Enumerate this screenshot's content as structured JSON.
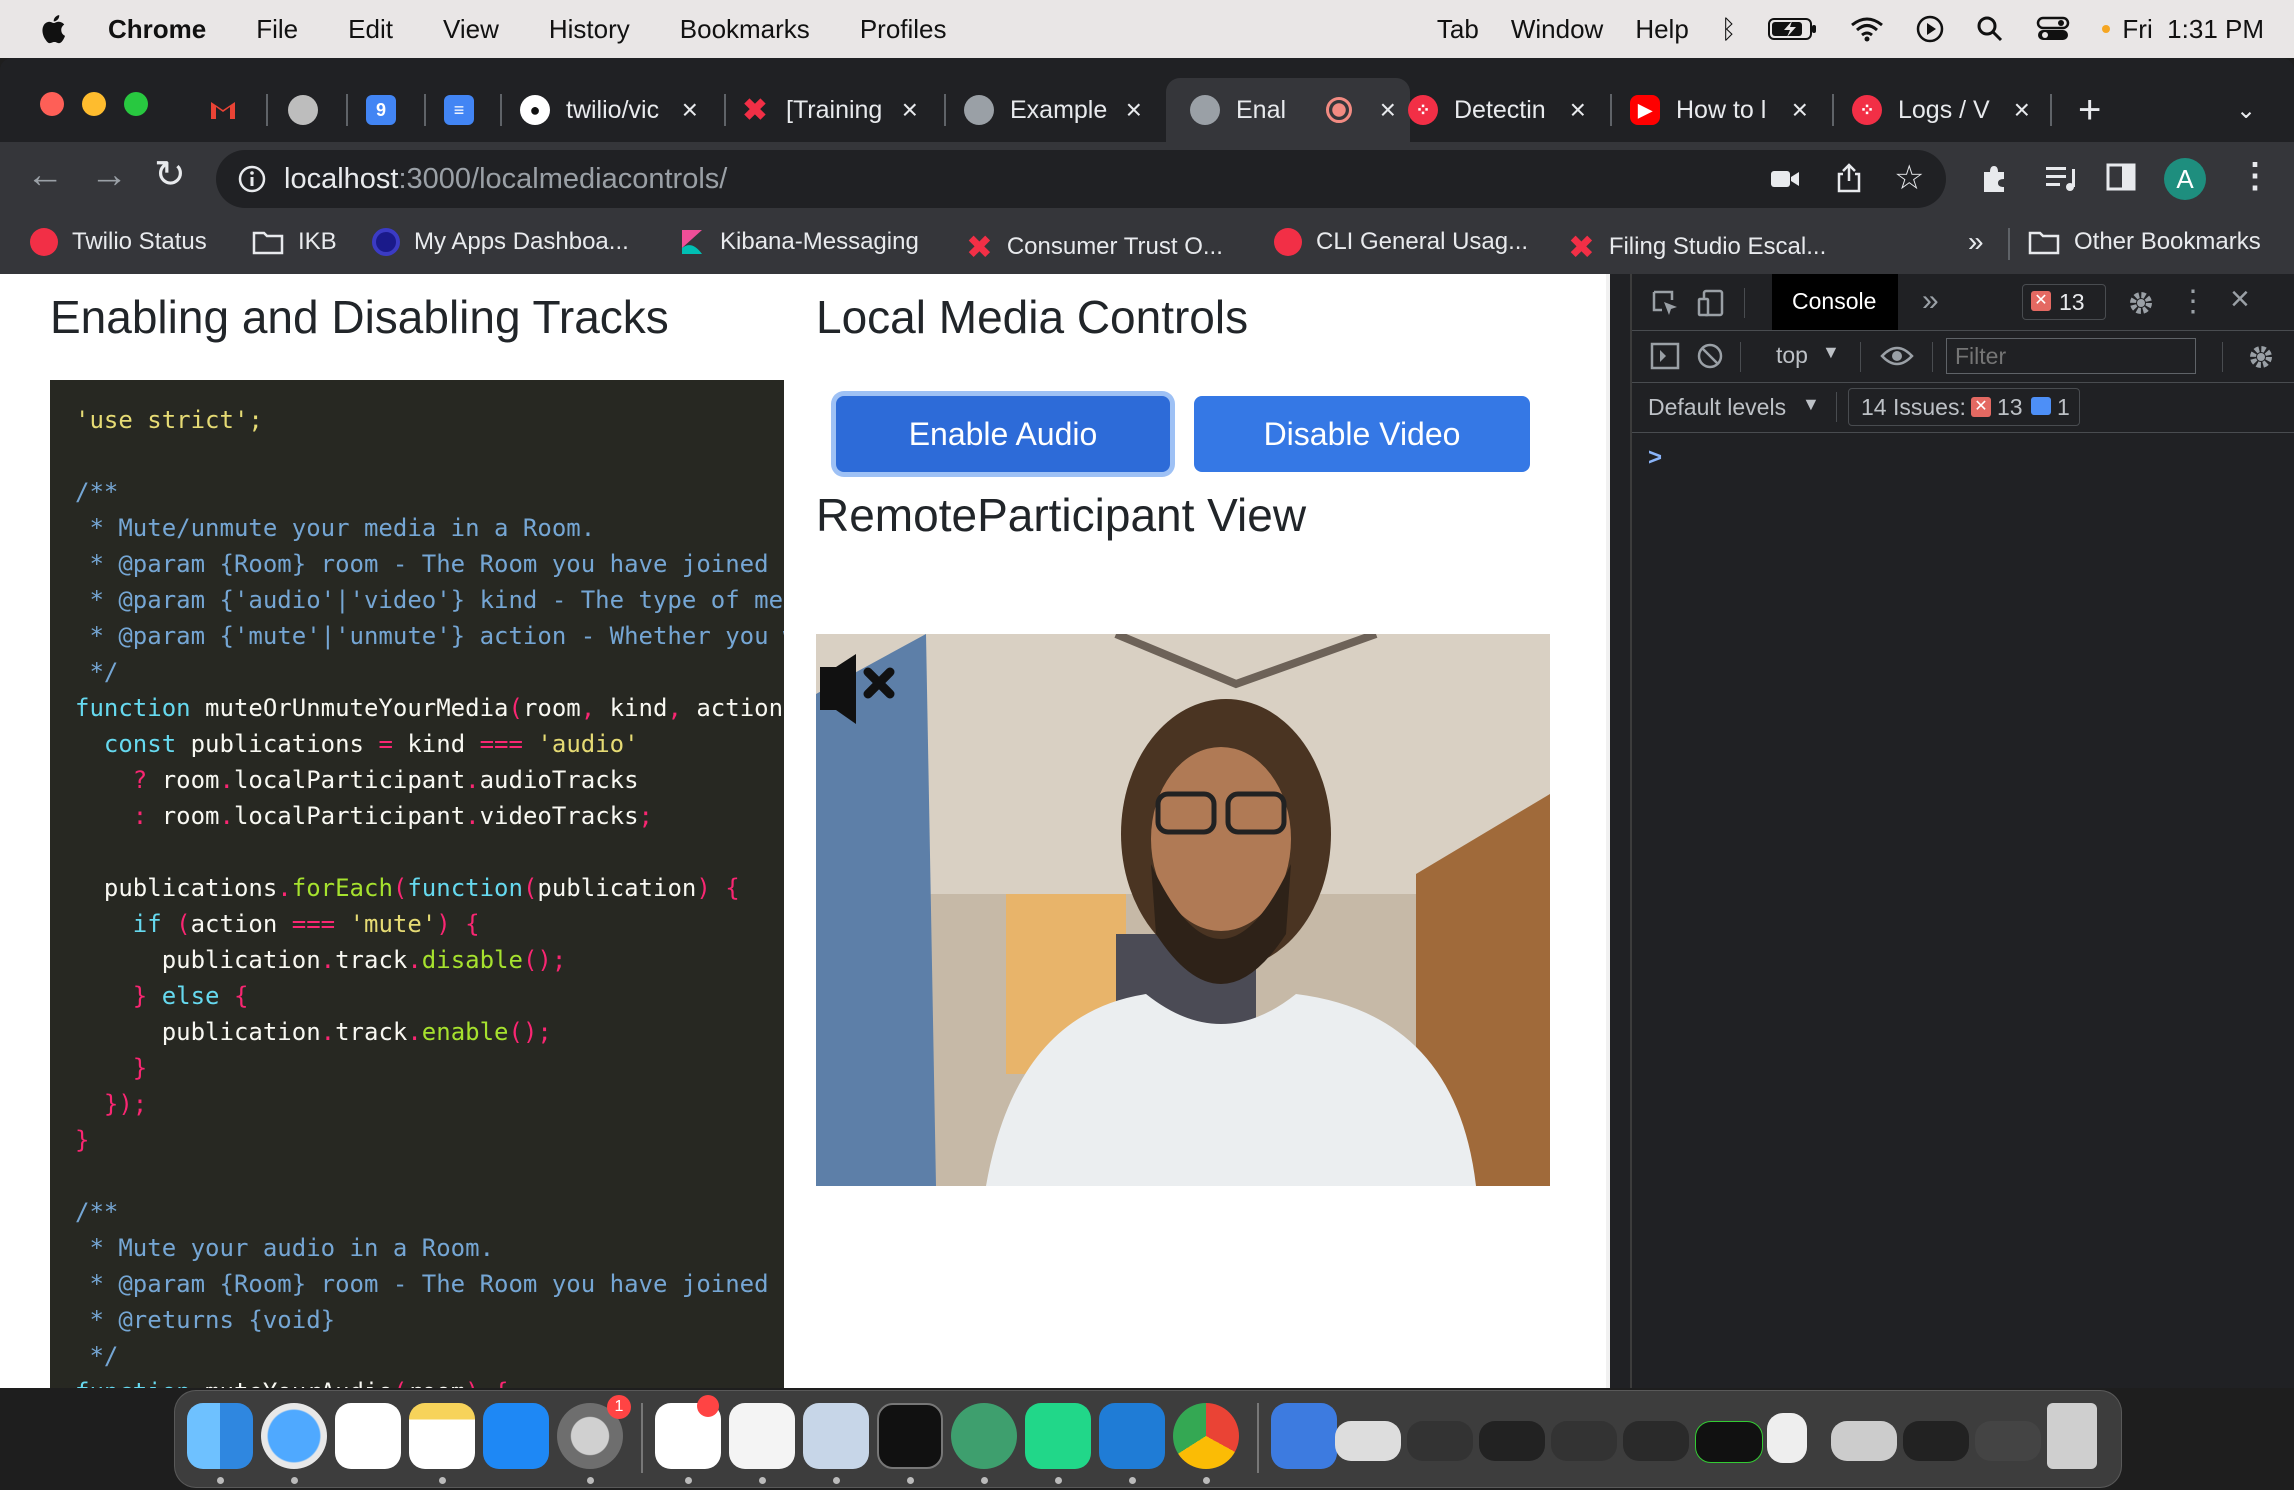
{
  "menubar": {
    "app": "Chrome",
    "items": [
      "File",
      "Edit",
      "View",
      "History",
      "Bookmarks",
      "Profiles"
    ],
    "right_items": [
      "Tab",
      "Window",
      "Help"
    ],
    "clock": "Fri  1:31 PM"
  },
  "tabs": [
    {
      "label": "",
      "icon": "gmail-icon"
    },
    {
      "label": "",
      "icon": "avatar-icon"
    },
    {
      "label": "",
      "icon": "calendar-icon"
    },
    {
      "label": "",
      "icon": "docs-icon"
    },
    {
      "label": "twilio/vic",
      "icon": "github-icon"
    },
    {
      "label": "[Training",
      "icon": "twilio-x-icon"
    },
    {
      "label": "Example",
      "icon": "globe-icon"
    },
    {
      "label": "Enal",
      "icon": "globe-icon",
      "active": true
    },
    {
      "label": "Detectin",
      "icon": "twilio-icon"
    },
    {
      "label": "How to l",
      "icon": "youtube-icon"
    },
    {
      "label": "Logs / V",
      "icon": "twilio-icon"
    }
  ],
  "address": {
    "host": "localhost",
    "path": ":3000/localmediacontrols/"
  },
  "bookmarks": [
    {
      "label": "Twilio Status",
      "icon": "twilio-icon"
    },
    {
      "label": "IKB",
      "icon": "folder-icon"
    },
    {
      "label": "My Apps Dashboa...",
      "icon": "okta-icon"
    },
    {
      "label": "Kibana-Messaging",
      "icon": "kibana-icon"
    },
    {
      "label": "Consumer Trust O...",
      "icon": "twilio-x-icon"
    },
    {
      "label": "CLI General Usag...",
      "icon": "twilio-icon"
    },
    {
      "label": "Filing Studio Escal...",
      "icon": "twilio-x-icon"
    }
  ],
  "bookmarks_overflow": "»",
  "other_bookmarks": "Other Bookmarks",
  "page": {
    "left_title": "Enabling and Disabling Tracks",
    "right_title": "Local Media Controls",
    "enable_audio": "Enable Audio",
    "disable_video": "Disable Video",
    "remote_title": "RemoteParticipant View"
  },
  "code_lines": [
    [
      [
        "'use strict';",
        "str"
      ]
    ],
    [
      [
        "",
        "pu"
      ]
    ],
    [
      [
        "/**",
        "cm"
      ]
    ],
    [
      [
        " * Mute/unmute your media in a Room.",
        "cm"
      ]
    ],
    [
      [
        " * @param {Room} room - The Room you have joined",
        "cm"
      ]
    ],
    [
      [
        " * @param {'audio'|'video'} kind - The type of med",
        "cm"
      ]
    ],
    [
      [
        " * @param {'mute'|'unmute'} action - Whether you w",
        "cm"
      ]
    ],
    [
      [
        " */",
        "cm"
      ]
    ],
    [
      [
        "function",
        "kw"
      ],
      [
        " muteOrUnmuteYourMedia",
        "pu"
      ],
      [
        "(",
        "pl"
      ],
      [
        "room",
        "pu"
      ],
      [
        ", ",
        "pl"
      ],
      [
        "kind",
        "pu"
      ],
      [
        ", ",
        "pl"
      ],
      [
        "action",
        "pu"
      ]
    ],
    [
      [
        "  const",
        "kw"
      ],
      [
        " publications ",
        "pu"
      ],
      [
        "=",
        "pl"
      ],
      [
        " kind ",
        "pu"
      ],
      [
        "===",
        "pl"
      ],
      [
        " 'audio'",
        "str"
      ]
    ],
    [
      [
        "    ?",
        "pl"
      ],
      [
        " room",
        "pu"
      ],
      [
        ".",
        "pl"
      ],
      [
        "localParticipant",
        "pu"
      ],
      [
        ".",
        "pl"
      ],
      [
        "audioTracks",
        "pu"
      ]
    ],
    [
      [
        "    :",
        "pl"
      ],
      [
        " room",
        "pu"
      ],
      [
        ".",
        "pl"
      ],
      [
        "localParticipant",
        "pu"
      ],
      [
        ".",
        "pl"
      ],
      [
        "videoTracks",
        "pu"
      ],
      [
        ";",
        "pl"
      ]
    ],
    [
      [
        "",
        "pu"
      ]
    ],
    [
      [
        "  publications",
        "pu"
      ],
      [
        ".",
        "pl"
      ],
      [
        "forEach",
        "fn"
      ],
      [
        "(",
        "pl"
      ],
      [
        "function",
        "kw"
      ],
      [
        "(",
        "pl"
      ],
      [
        "publication",
        "pu"
      ],
      [
        ") {",
        "pl"
      ]
    ],
    [
      [
        "    if",
        "kw"
      ],
      [
        " (",
        "pl"
      ],
      [
        "action ",
        "pu"
      ],
      [
        "===",
        "pl"
      ],
      [
        " 'mute'",
        "str"
      ],
      [
        ") {",
        "pl"
      ]
    ],
    [
      [
        "      publication",
        "pu"
      ],
      [
        ".",
        "pl"
      ],
      [
        "track",
        "pu"
      ],
      [
        ".",
        "pl"
      ],
      [
        "disable",
        "fn"
      ],
      [
        "();",
        "pl"
      ]
    ],
    [
      [
        "    } ",
        "pl"
      ],
      [
        "else",
        "kw"
      ],
      [
        " {",
        "pl"
      ]
    ],
    [
      [
        "      publication",
        "pu"
      ],
      [
        ".",
        "pl"
      ],
      [
        "track",
        "pu"
      ],
      [
        ".",
        "pl"
      ],
      [
        "enable",
        "fn"
      ],
      [
        "();",
        "pl"
      ]
    ],
    [
      [
        "    }",
        "pl"
      ]
    ],
    [
      [
        "  });",
        "pl"
      ]
    ],
    [
      [
        "}",
        "pl"
      ]
    ],
    [
      [
        "",
        "pu"
      ]
    ],
    [
      [
        "/**",
        "cm"
      ]
    ],
    [
      [
        " * Mute your audio in a Room.",
        "cm"
      ]
    ],
    [
      [
        " * @param {Room} room - The Room you have joined",
        "cm"
      ]
    ],
    [
      [
        " * @returns {void}",
        "cm"
      ]
    ],
    [
      [
        " */",
        "cm"
      ]
    ],
    [
      [
        "function",
        "kw"
      ],
      [
        " muteYourAudio",
        "pu"
      ],
      [
        "(",
        "pl"
      ],
      [
        "room",
        "pu"
      ],
      [
        ") {",
        "pl"
      ]
    ]
  ],
  "devtools": {
    "tab": "Console",
    "error_badge": "13",
    "context": "top",
    "filter_placeholder": "Filter",
    "levels": "Default levels",
    "issues_label": "14 Issues:",
    "issues_errors": "13",
    "issues_info": "1",
    "prompt": ">"
  },
  "dock_badges": {
    "system_prefs": "1"
  },
  "colors": {
    "accent": "#3578e5",
    "code_bg": "#272822",
    "chrome_dark": "#202124"
  }
}
